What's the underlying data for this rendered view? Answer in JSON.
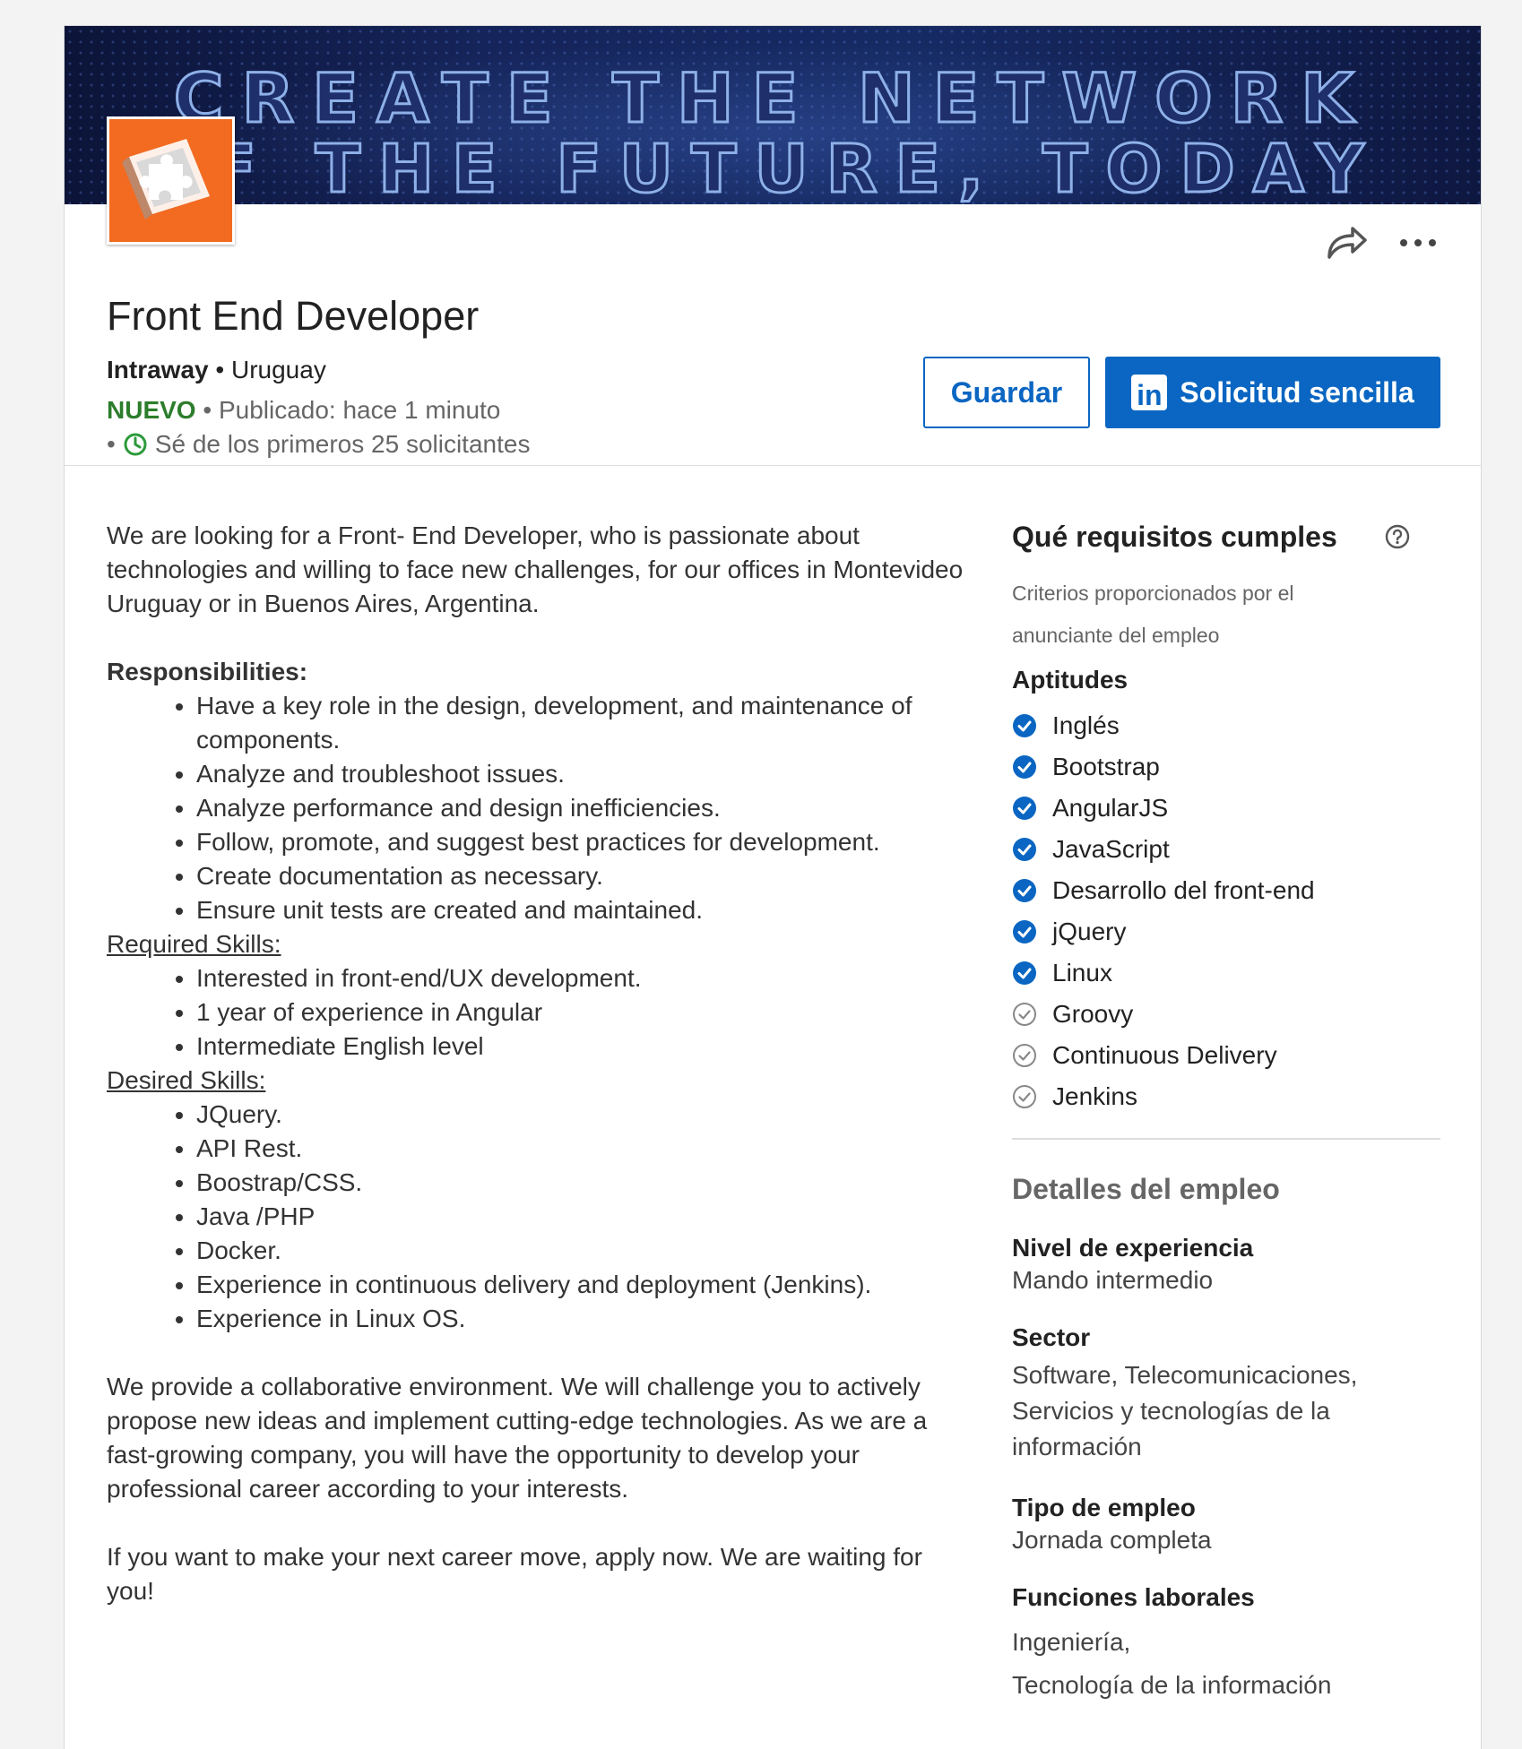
{
  "banner": {
    "line1": "CREATE THE NETWORK",
    "line2": "OF THE FUTURE, TODAY"
  },
  "job": {
    "title": "Front End Developer",
    "company": "Intraway",
    "separator": " • ",
    "location": "Uruguay",
    "badge_new": "NUEVO",
    "published": " • Publicado: hace 1 minuto",
    "bullet": "•",
    "applicants": "Sé de los primeros 25 solicitantes"
  },
  "actions": {
    "save_label": "Guardar",
    "apply_label": "Solicitud sencilla",
    "apply_logo": "in"
  },
  "description": {
    "intro": "We are looking for a Front- End Developer, who is passionate about technologies and willing to face new challenges, for our offices in Montevideo Uruguay or in Buenos Aires, Argentina.",
    "responsibilities_heading": "Responsibilities:",
    "responsibilities": [
      "Have a key role in the design, development, and maintenance of components.",
      "Analyze and troubleshoot issues.",
      "Analyze performance and design inefficiencies.",
      "Follow, promote, and suggest best practices for development.",
      "Create documentation as necessary.",
      "Ensure unit tests are created and maintained."
    ],
    "required_heading": "Required Skills:",
    "required": [
      "Interested in front-end/UX development.",
      "1 year of experience in Angular",
      "Intermediate English level"
    ],
    "desired_heading": "Desired Skills:",
    "desired": [
      "JQuery.",
      "API Rest.",
      "Boostrap/CSS.",
      "Java /PHP",
      "Docker.",
      "Experience in continuous delivery and deployment (Jenkins).",
      "Experience in Linux OS."
    ],
    "closing1": "We provide a collaborative environment. We will challenge you to actively propose new ideas and implement cutting-edge technologies. As we are a fast-growing company, you will have the opportunity to develop your professional career according to your interests.",
    "closing2": "If you want to make your next career move, apply now. We are waiting for you!"
  },
  "requirements": {
    "heading": "Qué requisitos cumples",
    "subtitle": "Criterios proporcionados por el anunciante del empleo",
    "skills_heading": "Aptitudes",
    "skills": [
      {
        "name": "Inglés",
        "matched": true
      },
      {
        "name": "Bootstrap",
        "matched": true
      },
      {
        "name": "AngularJS",
        "matched": true
      },
      {
        "name": "JavaScript",
        "matched": true
      },
      {
        "name": "Desarrollo del front-end",
        "matched": true
      },
      {
        "name": "jQuery",
        "matched": true
      },
      {
        "name": "Linux",
        "matched": true
      },
      {
        "name": "Groovy",
        "matched": false
      },
      {
        "name": "Continuous Delivery",
        "matched": false
      },
      {
        "name": "Jenkins",
        "matched": false
      }
    ]
  },
  "details": {
    "heading": "Detalles del empleo",
    "experience_label": "Nivel de experiencia",
    "experience_value": "Mando intermedio",
    "sector_label": "Sector",
    "sector_value": "Software, Telecomunicaciones, Servicios y tecnologías de la información",
    "type_label": "Tipo de empleo",
    "type_value": "Jornada completa",
    "functions_label": "Funciones laborales",
    "functions_value_1": "Ingeniería,",
    "functions_value_2": "Tecnología de la información"
  },
  "colors": {
    "accent": "#0a66c2",
    "new_badge": "#2c7d2c",
    "logo_bg": "#f26b21",
    "banner_bg": "#15245a"
  },
  "icons": [
    "share-icon",
    "more-icon",
    "clock-icon",
    "linkedin-icon",
    "help-icon",
    "check-filled-icon",
    "check-outline-icon",
    "puzzle-logo-icon"
  ]
}
